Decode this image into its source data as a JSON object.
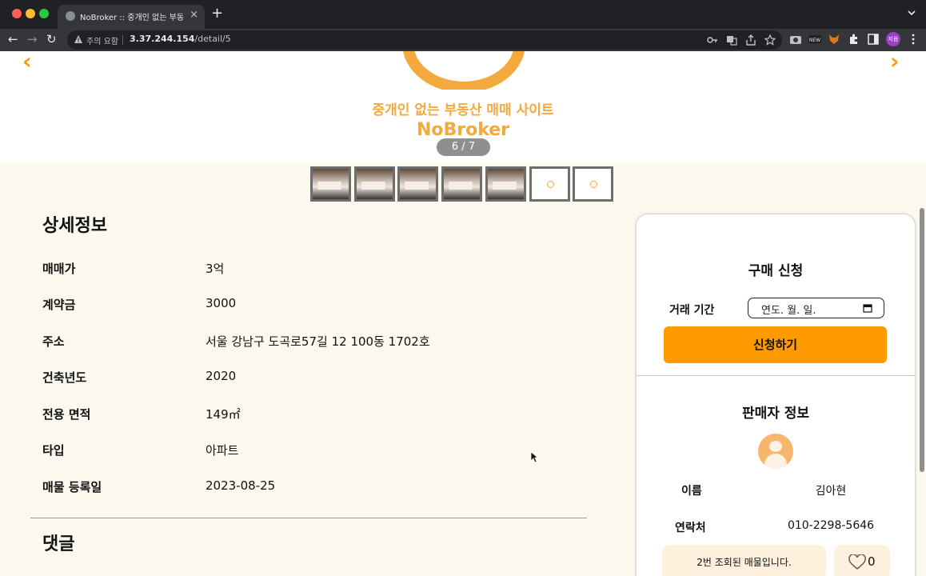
{
  "browser": {
    "tab_title": "NoBroker :: 중개인 없는 부동산 매매",
    "address_warning": "주의 요함",
    "url_host": "3.37.244.154",
    "url_path": "/detail/5",
    "profile_initials": "지음",
    "new_badge": "NEW"
  },
  "hero": {
    "tagline": "중개인 없는 부동산 매매 사이트",
    "brand": "NoBroker",
    "counter": "6 / 7",
    "accent_color": "#f4a93c",
    "thumbnails": [
      {
        "kind": "photo"
      },
      {
        "kind": "photo"
      },
      {
        "kind": "photo"
      },
      {
        "kind": "photo"
      },
      {
        "kind": "photo"
      },
      {
        "kind": "blank"
      },
      {
        "kind": "blank"
      }
    ]
  },
  "details": {
    "title": "상세정보",
    "rows": [
      {
        "label": "매매가",
        "value": "3억"
      },
      {
        "label": "계약금",
        "value": "3000"
      },
      {
        "label": "주소",
        "value": "서울 강남구 도곡로57길 12 100동 1702호"
      },
      {
        "label": "건축년도",
        "value": "2020"
      },
      {
        "label": "전용 면적",
        "value": "149㎡"
      },
      {
        "label": "타입",
        "value": "아파트"
      },
      {
        "label": "매물 등록일",
        "value": "2023-08-25"
      }
    ]
  },
  "comments": {
    "title": "댓글"
  },
  "purchase": {
    "title": "구매 신청",
    "period_label": "거래 기간",
    "date_placeholder": "연도. 월. 일.",
    "apply_label": "신청하기",
    "button_color": "#ff9b00"
  },
  "seller": {
    "title": "판매자 정보",
    "name_label": "이름",
    "name_value": "김아현",
    "contact_label": "연락처",
    "contact_value": "010-2298-5646",
    "views_text": "2번 조회된 매물입니다.",
    "likes": "0"
  }
}
